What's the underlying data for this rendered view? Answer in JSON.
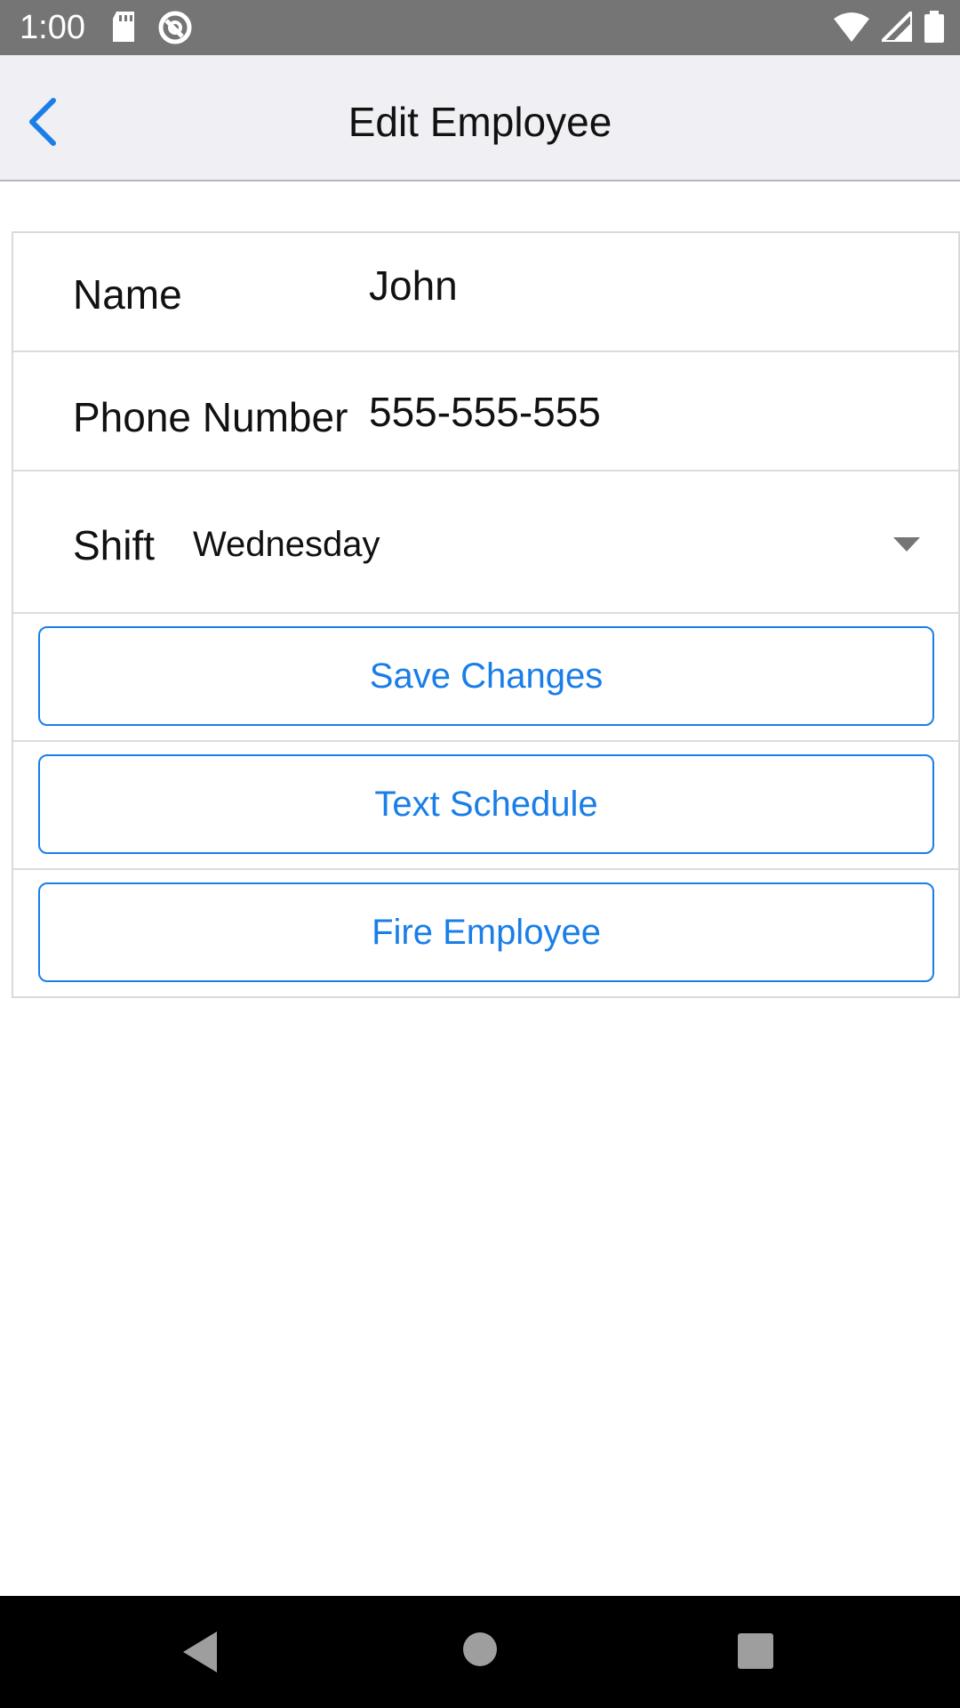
{
  "status_bar": {
    "time": "1:00",
    "icons": [
      "sd-card-icon",
      "sync-icon",
      "wifi-icon",
      "cell-signal-icon",
      "battery-icon"
    ]
  },
  "nav_bar": {
    "title": "Edit Employee",
    "back_icon": "chevron-left-icon"
  },
  "form": {
    "name": {
      "label": "Name",
      "value": "John"
    },
    "phone": {
      "label": "Phone Number",
      "value": "555-555-555"
    },
    "shift": {
      "label": "Shift",
      "value": "Wednesday"
    }
  },
  "buttons": {
    "save": "Save Changes",
    "text_schedule": "Text Schedule",
    "fire": "Fire Employee"
  },
  "colors": {
    "accent": "#1a7ee8",
    "status_bar": "#757575",
    "nav_bar": "#efeff4"
  }
}
